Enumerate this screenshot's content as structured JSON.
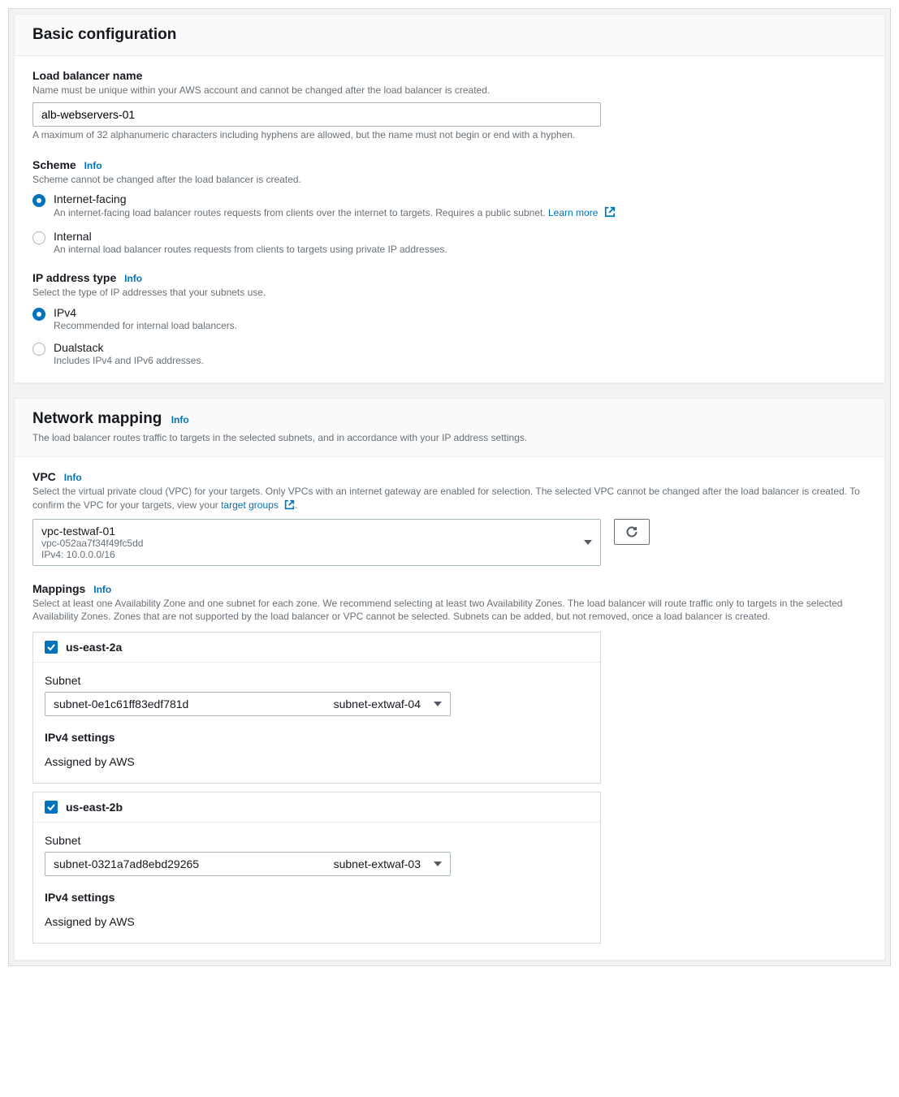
{
  "info_label": "Info",
  "basic": {
    "title": "Basic configuration",
    "name": {
      "label": "Load balancer name",
      "help": "Name must be unique within your AWS account and cannot be changed after the load balancer is created.",
      "value": "alb-webservers-01",
      "constraint": "A maximum of 32 alphanumeric characters including hyphens are allowed, but the name must not begin or end with a hyphen."
    },
    "scheme": {
      "label": "Scheme",
      "help": "Scheme cannot be changed after the load balancer is created.",
      "options": [
        {
          "label": "Internet-facing",
          "desc_pre": "An internet-facing load balancer routes requests from clients over the internet to targets. Requires a public subnet. ",
          "learn_more": "Learn more",
          "selected": true
        },
        {
          "label": "Internal",
          "desc": "An internal load balancer routes requests from clients to targets using private IP addresses.",
          "selected": false
        }
      ]
    },
    "ip_type": {
      "label": "IP address type",
      "help": "Select the type of IP addresses that your subnets use.",
      "options": [
        {
          "label": "IPv4",
          "desc": "Recommended for internal load balancers.",
          "selected": true
        },
        {
          "label": "Dualstack",
          "desc": "Includes IPv4 and IPv6 addresses.",
          "selected": false
        }
      ]
    }
  },
  "network": {
    "title": "Network mapping",
    "subtitle": "The load balancer routes traffic to targets in the selected subnets, and in accordance with your IP address settings.",
    "vpc": {
      "label": "VPC",
      "help_pre": "Select the virtual private cloud (VPC) for your targets. Only VPCs with an internet gateway are enabled for selection. The selected VPC cannot be changed after the load balancer is created. To confirm the VPC for your targets, view your ",
      "target_groups_link": "target groups",
      "selected": {
        "name": "vpc-testwaf-01",
        "id": "vpc-052aa7f34f49fc5dd",
        "cidr": "IPv4: 10.0.0.0/16"
      }
    },
    "mappings": {
      "label": "Mappings",
      "help": "Select at least one Availability Zone and one subnet for each zone. We recommend selecting at least two Availability Zones. The load balancer will route traffic only to targets in the selected Availability Zones. Zones that are not supported by the load balancer or VPC cannot be selected. Subnets can be added, but not removed, once a load balancer is created.",
      "subnet_label": "Subnet",
      "ipv4_settings_label": "IPv4 settings",
      "ipv4_assigned": "Assigned by AWS",
      "zones": [
        {
          "az": "us-east-2a",
          "subnet_id": "subnet-0e1c61ff83edf781d",
          "subnet_name": "subnet-extwaf-04"
        },
        {
          "az": "us-east-2b",
          "subnet_id": "subnet-0321a7ad8ebd29265",
          "subnet_name": "subnet-extwaf-03"
        }
      ]
    }
  }
}
